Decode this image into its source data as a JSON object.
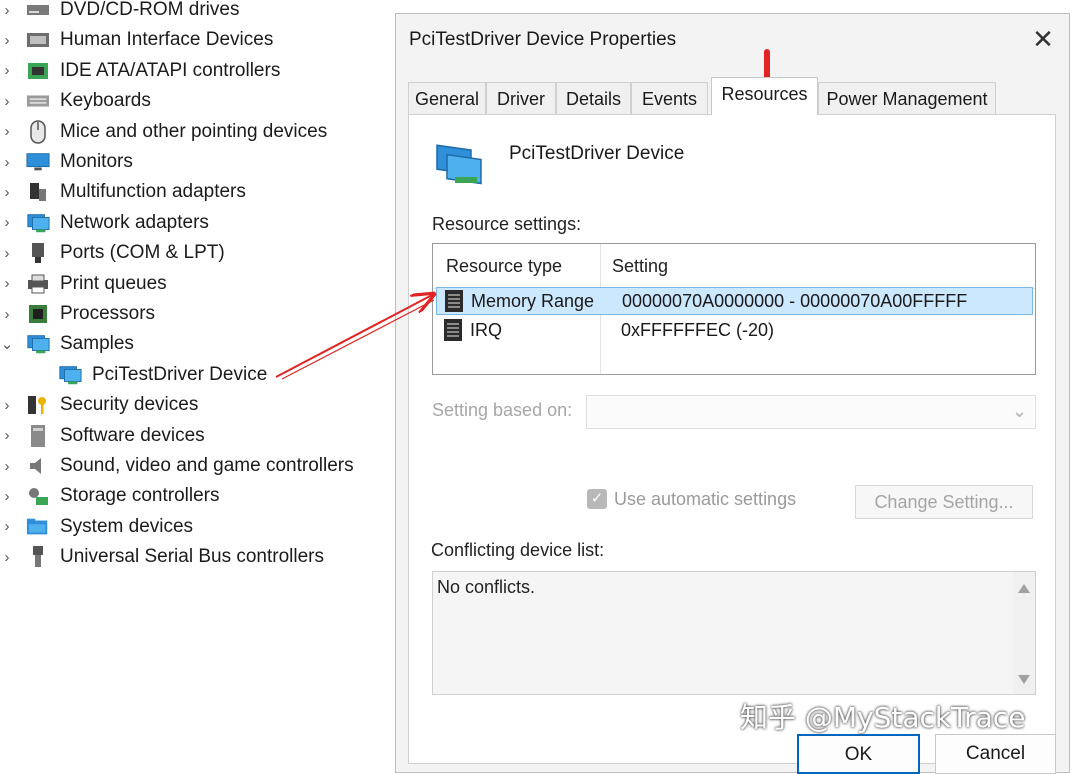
{
  "device_tree": {
    "items": [
      {
        "label": "DVD/CD-ROM drives",
        "expanded": false,
        "icon": "dvd-drive-icon"
      },
      {
        "label": "Human Interface Devices",
        "expanded": false,
        "icon": "hid-icon"
      },
      {
        "label": "IDE ATA/ATAPI controllers",
        "expanded": false,
        "icon": "ide-controller-icon"
      },
      {
        "label": "Keyboards",
        "expanded": false,
        "icon": "keyboard-icon"
      },
      {
        "label": "Mice and other pointing devices",
        "expanded": false,
        "icon": "mouse-icon"
      },
      {
        "label": "Monitors",
        "expanded": false,
        "icon": "monitor-icon"
      },
      {
        "label": "Multifunction adapters",
        "expanded": false,
        "icon": "multifunction-icon"
      },
      {
        "label": "Network adapters",
        "expanded": false,
        "icon": "network-adapter-icon"
      },
      {
        "label": "Ports (COM & LPT)",
        "expanded": false,
        "icon": "port-icon"
      },
      {
        "label": "Print queues",
        "expanded": false,
        "icon": "printer-icon"
      },
      {
        "label": "Processors",
        "expanded": false,
        "icon": "processor-icon"
      },
      {
        "label": "Samples",
        "expanded": true,
        "icon": "network-adapter-icon"
      },
      {
        "label": "PciTestDriver Device",
        "child": true,
        "icon": "network-adapter-icon"
      },
      {
        "label": "Security devices",
        "expanded": false,
        "icon": "security-device-icon"
      },
      {
        "label": "Software devices",
        "expanded": false,
        "icon": "software-device-icon"
      },
      {
        "label": "Sound, video and game controllers",
        "expanded": false,
        "icon": "speaker-icon"
      },
      {
        "label": "Storage controllers",
        "expanded": false,
        "icon": "storage-controller-icon"
      },
      {
        "label": "System devices",
        "expanded": false,
        "icon": "system-folder-icon"
      },
      {
        "label": "Universal Serial Bus controllers",
        "expanded": false,
        "icon": "usb-icon"
      }
    ]
  },
  "dialog": {
    "title": "PciTestDriver Device Properties",
    "close_glyph": "✕",
    "tabs": [
      "General",
      "Driver",
      "Details",
      "Events",
      "Resources",
      "Power Management"
    ],
    "active_tab": "Resources",
    "device_name": "PciTestDriver Device",
    "resource_settings_label": "Resource settings:",
    "columns": {
      "type": "Resource type",
      "setting": "Setting"
    },
    "resources": [
      {
        "type": "Memory Range",
        "setting": "00000070A0000000 - 00000070A00FFFFF",
        "selected": true
      },
      {
        "type": "IRQ",
        "setting": "0xFFFFFFEC (-20)",
        "selected": false
      }
    ],
    "setting_based_on_label": "Setting based on:",
    "setting_based_on_value": "",
    "use_automatic_label": "Use automatic settings",
    "use_automatic_checked": true,
    "change_setting_label": "Change Setting...",
    "conflicting_label": "Conflicting device list:",
    "conflicts_text": "No conflicts.",
    "ok_label": "OK",
    "cancel_label": "Cancel"
  },
  "watermark": "知乎 @MyStackTrace",
  "colors": {
    "selection": "#cce8ff",
    "accent": "#0067c0",
    "annotation_red": "#e02424"
  }
}
